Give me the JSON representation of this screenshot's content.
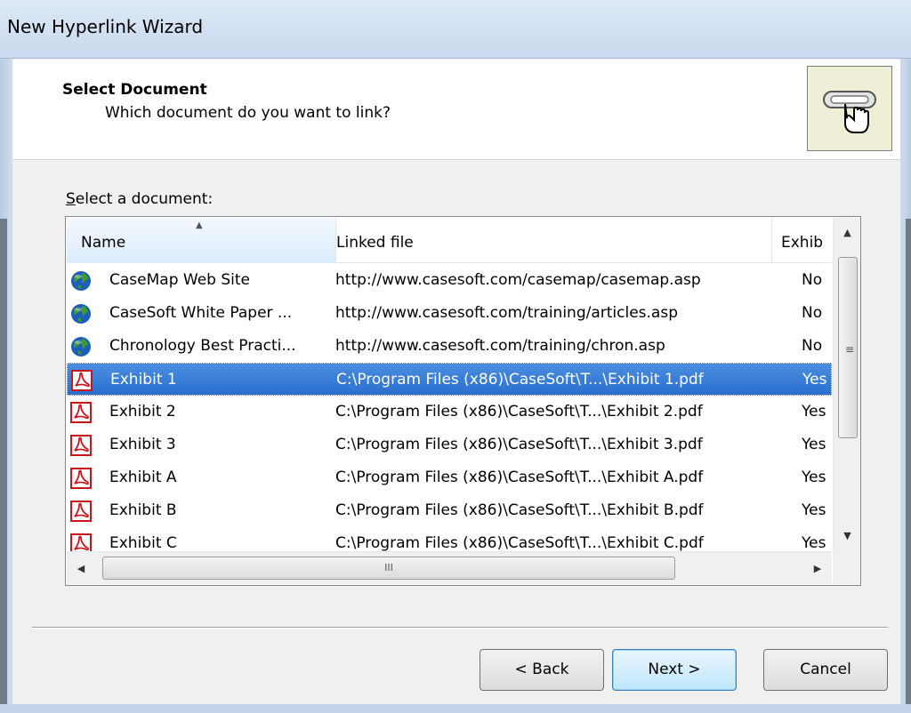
{
  "window": {
    "title": "New Hyperlink Wizard"
  },
  "header": {
    "heading": "Select Document",
    "subheading": "Which document do you want to link?",
    "icon": "link-hand-icon"
  },
  "list": {
    "label_prefix": "S",
    "label_rest": "elect a document:",
    "columns": [
      "Name",
      "Linked file",
      "Exhib"
    ],
    "sorted_column": "Name",
    "rows": [
      {
        "icon": "globe-icon",
        "name": "CaseMap Web Site",
        "file": "http://www.casesoft.com/casemap/casemap.asp",
        "exhibit": "No",
        "selected": false
      },
      {
        "icon": "globe-icon",
        "name": "CaseSoft White Paper ...",
        "file": "http://www.casesoft.com/training/articles.asp",
        "exhibit": "No",
        "selected": false
      },
      {
        "icon": "globe-icon",
        "name": "Chronology Best Practi...",
        "file": "http://www.casesoft.com/training/chron.asp",
        "exhibit": "No",
        "selected": false
      },
      {
        "icon": "pdf-icon",
        "name": "Exhibit 1",
        "file": "C:\\Program Files (x86)\\CaseSoft\\T...\\Exhibit 1.pdf",
        "exhibit": "Yes",
        "selected": true
      },
      {
        "icon": "pdf-icon",
        "name": "Exhibit 2",
        "file": "C:\\Program Files (x86)\\CaseSoft\\T...\\Exhibit 2.pdf",
        "exhibit": "Yes",
        "selected": false
      },
      {
        "icon": "pdf-icon",
        "name": "Exhibit 3",
        "file": "C:\\Program Files (x86)\\CaseSoft\\T...\\Exhibit 3.pdf",
        "exhibit": "Yes",
        "selected": false
      },
      {
        "icon": "pdf-icon",
        "name": "Exhibit A",
        "file": "C:\\Program Files (x86)\\CaseSoft\\T...\\Exhibit A.pdf",
        "exhibit": "Yes",
        "selected": false
      },
      {
        "icon": "pdf-icon",
        "name": "Exhibit B",
        "file": "C:\\Program Files (x86)\\CaseSoft\\T...\\Exhibit B.pdf",
        "exhibit": "Yes",
        "selected": false
      },
      {
        "icon": "pdf-icon",
        "name": "Exhibit C",
        "file": "C:\\Program Files (x86)\\CaseSoft\\T...\\Exhibit C.pdf",
        "exhibit": "Yes",
        "selected": false
      }
    ],
    "hscroll_grip": "III"
  },
  "buttons": {
    "back": "< Back",
    "next": "Next >",
    "cancel": "Cancel"
  },
  "colors": {
    "selection": "#3079d6",
    "title_bar": "#d3e2f3",
    "pdf_red": "#c8161d",
    "globe_blue": "#1d5fb8",
    "globe_green": "#3f9a2f"
  }
}
